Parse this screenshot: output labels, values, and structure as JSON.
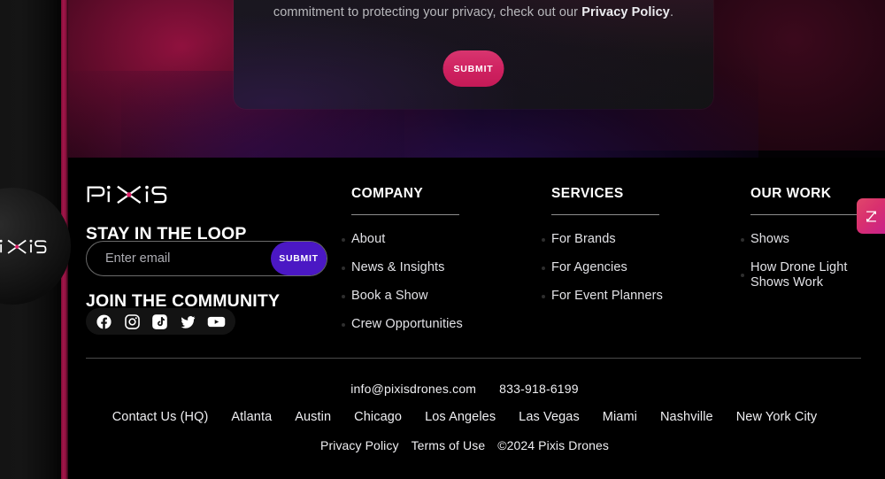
{
  "modal": {
    "body_text_before": "commitment to protecting your privacy, check out our ",
    "body_link": "Privacy Policy",
    "body_text_after": ".",
    "submit_label": "SUBMIT"
  },
  "brand": {
    "logo_text": "PiXiS",
    "badge_logo_text": "PiXiS"
  },
  "newsletter": {
    "heading": "STAY IN THE LOOP",
    "placeholder": "Enter email",
    "value": "",
    "submit_label": "SUBMIT"
  },
  "community": {
    "heading": "JOIN THE COMMUNITY",
    "socials": [
      {
        "name": "facebook-icon",
        "label": "Facebook"
      },
      {
        "name": "instagram-icon",
        "label": "Instagram"
      },
      {
        "name": "tiktok-icon",
        "label": "TikTok"
      },
      {
        "name": "twitter-icon",
        "label": "Twitter"
      },
      {
        "name": "youtube-icon",
        "label": "YouTube"
      }
    ]
  },
  "columns": {
    "company": {
      "title": "COMPANY",
      "items": [
        "About",
        "News & Insights",
        "Book a Show",
        "Crew Opportunities"
      ]
    },
    "services": {
      "title": "SERVICES",
      "items": [
        "For Brands",
        "For Agencies",
        "For Event Planners"
      ]
    },
    "our_work": {
      "title": "OUR WORK",
      "items": [
        "Shows",
        "How Drone Light Shows Work"
      ]
    }
  },
  "contact": {
    "email": "info@pixisdrones.com",
    "phone": "833-918-6199"
  },
  "cities": [
    "Contact Us (HQ)",
    "Atlanta",
    "Austin",
    "Chicago",
    "Los Angeles",
    "Las Vegas",
    "Miami",
    "Nashville",
    "New York City"
  ],
  "legal": {
    "privacy": "Privacy Policy",
    "terms": "Terms of Use",
    "copyright": "©2024 Pixis Drones"
  },
  "widget": {
    "label": "Z",
    "name": "zendesk-launcher"
  },
  "colors": {
    "accent_pink": "#cf2160",
    "accent_violet": "#4b18c4",
    "rail_crimson": "#a3154a",
    "widget_gradient_start": "#e0476b",
    "widget_gradient_end": "#c9228b"
  }
}
